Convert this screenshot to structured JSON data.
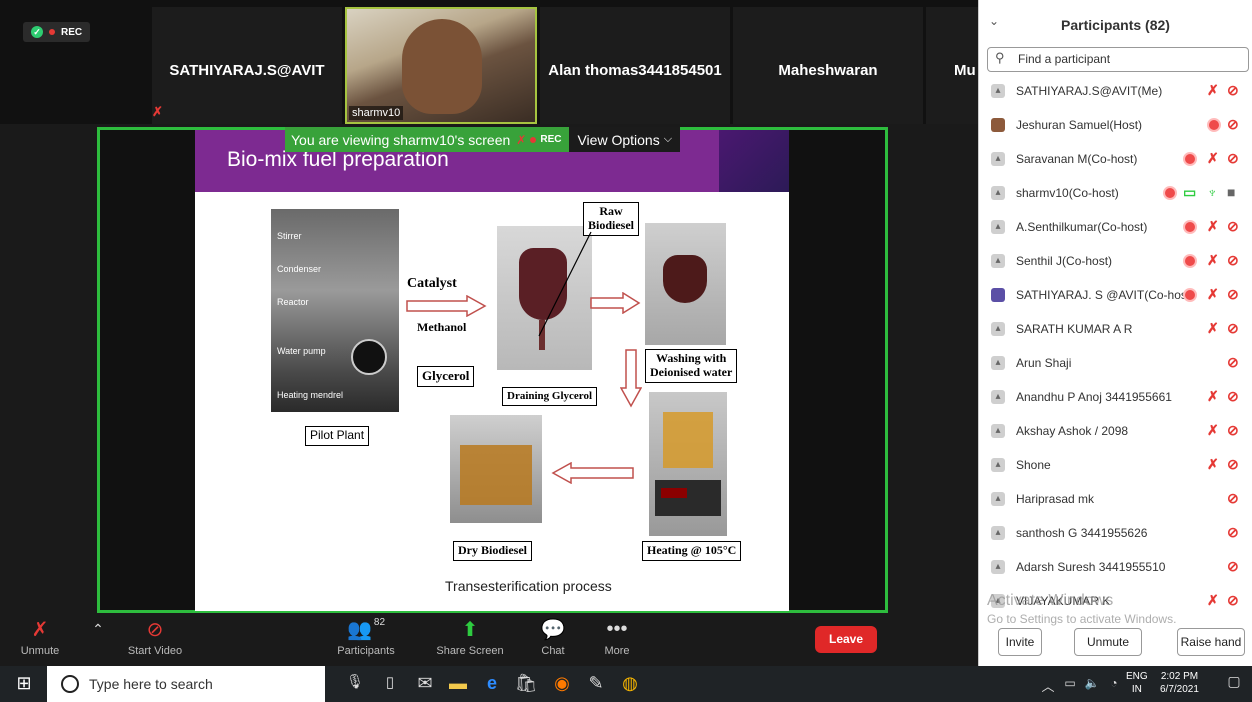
{
  "top_strip": {
    "rec_label": "REC",
    "tiles": [
      {
        "name": "SATHIYARAJ.S@AVIT"
      },
      {
        "name": "Alan thomas3441854501"
      },
      {
        "name": "Maheshwaran"
      },
      {
        "name": "Mu"
      }
    ],
    "active_video_label": "sharmv10"
  },
  "share_bar": {
    "viewing_text": "You are viewing sharmv10's screen",
    "rec_label": "REC",
    "view_options_label": "View Options"
  },
  "slide": {
    "title": "Bio-mix fuel preparation",
    "labels": {
      "stirrer": "Stirrer",
      "condenser": "Condenser",
      "reactor": "Reactor",
      "water_pump": "Water pump",
      "heating_mendrel": "Heating mendrel",
      "pilot_plant": "Pilot Plant",
      "catalyst": "Catalyst",
      "methanol": "Methanol",
      "raw_biodiesel_1": "Raw",
      "raw_biodiesel_2": "Biodiesel",
      "glycerol": "Glycerol",
      "draining_glycerol": "Draining Glycerol",
      "washing_1": "Washing with",
      "washing_2": "Deionised water",
      "dry_biodiesel": "Dry Biodiesel",
      "heating": "Heating @ 105°C"
    },
    "caption": "Transesterification process"
  },
  "toolbar": {
    "unmute": "Unmute",
    "start_video": "Start Video",
    "participants": "Participants",
    "participants_count": "82",
    "share_screen": "Share Screen",
    "chat": "Chat",
    "more": "More",
    "leave": "Leave"
  },
  "panel": {
    "title": "Participants (82)",
    "search_placeholder": "Find a participant",
    "participants": [
      {
        "name": "SATHIYARAJ.S@AVIT(Me)"
      },
      {
        "name": "Jeshuran Samuel(Host)"
      },
      {
        "name": "Saravanan M(Co-host)"
      },
      {
        "name": "sharmv10(Co-host)"
      },
      {
        "name": "A.Senthilkumar(Co-host)"
      },
      {
        "name": "Senthil J(Co-host)"
      },
      {
        "name": "SATHIYARAJ. S @AVIT(Co-host)"
      },
      {
        "name": "SARATH KUMAR A R"
      },
      {
        "name": "Arun Shaji"
      },
      {
        "name": "Anandhu P Anoj 3441955661"
      },
      {
        "name": "Akshay Ashok / 2098"
      },
      {
        "name": "Shone"
      },
      {
        "name": "Hariprasad mk"
      },
      {
        "name": "santhosh G 3441955626"
      },
      {
        "name": "Adarsh Suresh 3441955510"
      },
      {
        "name": "VIJAYAKUMAR K"
      }
    ],
    "watermark_line1": "Activate Windows",
    "watermark_line2": "Go to Settings to activate Windows.",
    "invite": "Invite",
    "unmute": "Unmute",
    "raise_hand": "Raise hand"
  },
  "taskbar": {
    "search_placeholder": "Type here to search",
    "lang_1": "ENG",
    "lang_2": "IN",
    "time": "2:02 PM",
    "date": "6/7/2021"
  }
}
